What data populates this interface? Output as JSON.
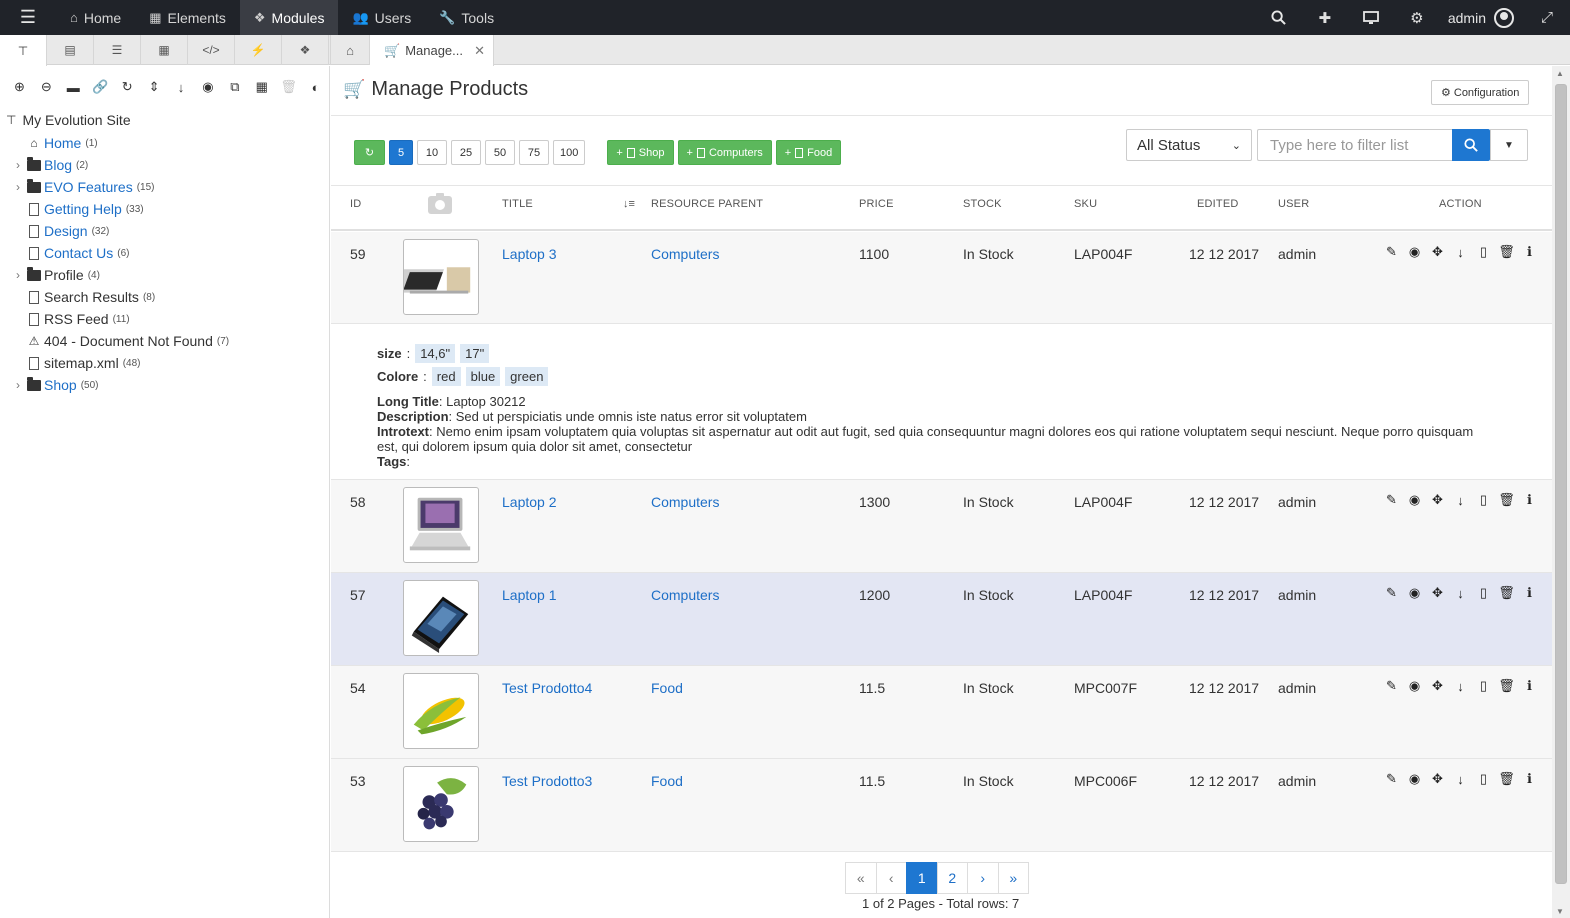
{
  "topbar": {
    "nav": [
      {
        "label": "Home",
        "icon": "home-icon"
      },
      {
        "label": "Elements",
        "icon": "grid-icon"
      },
      {
        "label": "Modules",
        "icon": "cubes-icon",
        "active": true
      },
      {
        "label": "Users",
        "icon": "users-icon"
      },
      {
        "label": "Tools",
        "icon": "wrench-icon"
      }
    ],
    "user": "admin"
  },
  "maintab": {
    "label": "Manage...",
    "close": "✕"
  },
  "sidebar": {
    "site_name": "My Evolution Site",
    "items": [
      {
        "label": "Home",
        "count": "(1)",
        "type": "home",
        "link": true,
        "expandable": false
      },
      {
        "label": "Blog",
        "count": "(2)",
        "type": "folder",
        "link": true,
        "expandable": true
      },
      {
        "label": "EVO Features",
        "count": "(15)",
        "type": "folder",
        "link": true,
        "expandable": true
      },
      {
        "label": "Getting Help",
        "count": "(33)",
        "type": "doc",
        "link": true,
        "expandable": false
      },
      {
        "label": "Design",
        "count": "(32)",
        "type": "doc",
        "link": true,
        "expandable": false
      },
      {
        "label": "Contact Us",
        "count": "(6)",
        "type": "doc",
        "link": true,
        "expandable": false
      },
      {
        "label": "Profile",
        "count": "(4)",
        "type": "folder",
        "link": false,
        "expandable": true
      },
      {
        "label": "Search Results",
        "count": "(8)",
        "type": "doc",
        "link": false,
        "expandable": false
      },
      {
        "label": "RSS Feed",
        "count": "(11)",
        "type": "code",
        "link": false,
        "expandable": false
      },
      {
        "label": "404 - Document Not Found",
        "count": "(7)",
        "type": "warning",
        "link": false,
        "expandable": false
      },
      {
        "label": "sitemap.xml",
        "count": "(48)",
        "type": "code",
        "link": false,
        "expandable": false
      },
      {
        "label": "Shop",
        "count": "(50)",
        "type": "folder",
        "link": true,
        "expandable": true
      }
    ]
  },
  "main": {
    "title": "Manage Products",
    "config_label": "Configuration",
    "page_sizes": [
      "5",
      "10",
      "25",
      "50",
      "75",
      "100"
    ],
    "active_page_size": "5",
    "add_buttons": [
      "Shop",
      "Computers",
      "Food"
    ],
    "status_filter": "All Status",
    "filter_placeholder": "Type here to filter list",
    "columns": {
      "id": "ID",
      "title": "TITLE",
      "parent": "RESOURCE PARENT",
      "price": "PRICE",
      "stock": "STOCK",
      "sku": "SKU",
      "edited": "EDITED",
      "user": "USER",
      "action": "ACTION"
    },
    "rows": [
      {
        "id": "59",
        "title": "Laptop 3",
        "parent": "Computers",
        "price": "1100",
        "stock": "In Stock",
        "sku": "LAP004F",
        "edited": "12 12 2017",
        "user": "admin"
      },
      {
        "id": "58",
        "title": "Laptop 2",
        "parent": "Computers",
        "price": "1300",
        "stock": "In Stock",
        "sku": "LAP004F",
        "edited": "12 12 2017",
        "user": "admin"
      },
      {
        "id": "57",
        "title": "Laptop 1",
        "parent": "Computers",
        "price": "1200",
        "stock": "In Stock",
        "sku": "LAP004F",
        "edited": "12 12 2017",
        "user": "admin"
      },
      {
        "id": "54",
        "title": "Test Prodotto4",
        "parent": "Food",
        "price": "11.5",
        "stock": "In Stock",
        "sku": "MPC007F",
        "edited": "12 12 2017",
        "user": "admin"
      },
      {
        "id": "53",
        "title": "Test Prodotto3",
        "parent": "Food",
        "price": "11.5",
        "stock": "In Stock",
        "sku": "MPC006F",
        "edited": "12 12 2017",
        "user": "admin"
      }
    ],
    "detail": {
      "size_label": "size",
      "sizes": [
        "14,6\"",
        "17\""
      ],
      "colore_label": "Colore",
      "colors": [
        "red",
        "blue",
        "green"
      ],
      "long_title_label": "Long Title",
      "long_title": "Laptop 30212",
      "description_label": "Description",
      "description": "Sed ut perspiciatis unde omnis iste natus error sit voluptatem",
      "introtext_label": "Introtext",
      "introtext": "Nemo enim ipsam voluptatem quia voluptas sit aspernatur aut odit aut fugit, sed quia consequuntur magni dolores eos qui ratione voluptatem sequi nesciunt. Neque porro quisquam est, qui dolorem ipsum quia dolor sit amet, consectetur",
      "tags_label": "Tags"
    },
    "pagination": {
      "first": "«",
      "prev": "‹",
      "pages": [
        "1",
        "2"
      ],
      "current": "1",
      "next": "›",
      "last": "»",
      "info": "1 of 2 Pages - Total rows: 7"
    }
  }
}
